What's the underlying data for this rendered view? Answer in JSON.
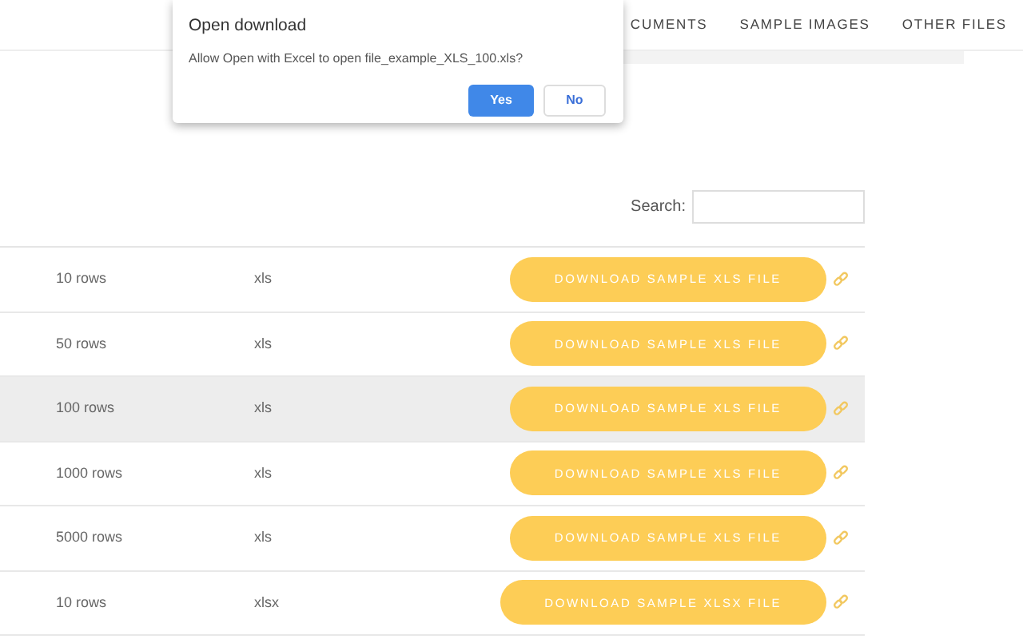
{
  "nav": {
    "items": [
      "CUMENTS",
      "SAMPLE IMAGES",
      "OTHER FILES"
    ]
  },
  "dialog": {
    "title": "Open download",
    "message": "Allow Open with Excel to open file_example_XLS_100.xls?",
    "buttons": [
      {
        "label": "Yes",
        "kind": "primary"
      },
      {
        "label": "No",
        "kind": "secondary"
      }
    ]
  },
  "search": {
    "label": "Search:"
  },
  "table": {
    "rows": [
      {
        "size": "10 rows",
        "format": "xls",
        "button": "DOWNLOAD SAMPLE XLS FILE",
        "selected": false
      },
      {
        "size": "50 rows",
        "format": "xls",
        "button": "DOWNLOAD SAMPLE XLS FILE",
        "selected": false
      },
      {
        "size": "100 rows",
        "format": "xls",
        "button": "DOWNLOAD SAMPLE XLS FILE",
        "selected": true
      },
      {
        "size": "1000 rows",
        "format": "xls",
        "button": "DOWNLOAD SAMPLE XLS FILE",
        "selected": false
      },
      {
        "size": "5000 rows",
        "format": "xls",
        "button": "DOWNLOAD SAMPLE XLS FILE",
        "selected": false
      },
      {
        "size": "10 rows",
        "format": "xlsx",
        "button": "DOWNLOAD SAMPLE XLSX FILE",
        "selected": false
      }
    ]
  }
}
